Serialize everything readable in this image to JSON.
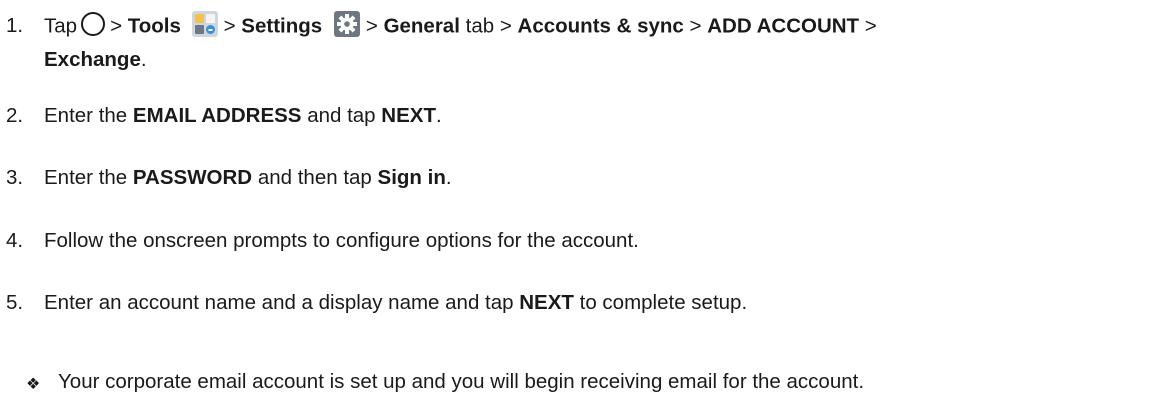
{
  "steps": [
    {
      "num": "1.",
      "tap": "Tap",
      "sep": ">",
      "tools": "Tools",
      "settings": "Settings",
      "general": "General",
      "tab": "tab",
      "accounts": "Accounts & sync",
      "add_account": "ADD ACCOUNT",
      "exchange": "Exchange",
      "period": ".",
      "icons": [
        "home-icon",
        "tools-icon",
        "settings-icon"
      ]
    },
    {
      "num": "2.",
      "pre": "Enter the",
      "bold1": "EMAIL ADDRESS",
      "mid": "and tap",
      "bold2": "NEXT",
      "post": "."
    },
    {
      "num": "3.",
      "pre": "Enter the",
      "bold1": "PASSWORD",
      "mid": "and then tap",
      "bold2": "Sign in",
      "post": "."
    },
    {
      "num": "4.",
      "text": "Follow the onscreen prompts to configure options for the account."
    },
    {
      "num": "5.",
      "pre": "Enter an account name and a display name and tap",
      "bold": "NEXT",
      "post": "to complete setup."
    }
  ],
  "result": {
    "bullet": "❖",
    "text": "Your corporate email account is set up and you will begin receiving email for the account."
  }
}
